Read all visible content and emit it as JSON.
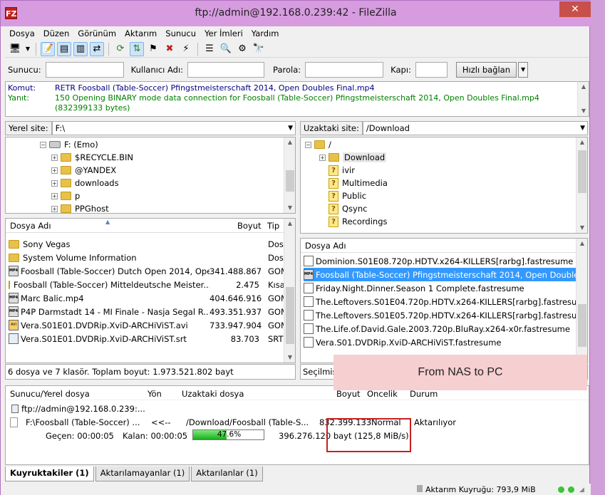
{
  "window": {
    "title": "ftp://admin@192.168.0.239:42 - FileZilla",
    "app_icon": "FZ",
    "close_glyph": "✕"
  },
  "menu": [
    "Dosya",
    "Düzen",
    "Görünüm",
    "Aktarım",
    "Sunucu",
    "Yer İmleri",
    "Yardım"
  ],
  "quickconnect": {
    "host_label": "Sunucu:",
    "user_label": "Kullanıcı Adı:",
    "pass_label": "Parola:",
    "port_label": "Kapı:",
    "button": "Hızlı bağlan",
    "host_value": "",
    "user_value": "",
    "pass_value": "",
    "port_value": ""
  },
  "log": {
    "cmd_label": "Komut:",
    "cmd_text": "RETR Foosball (Table-Soccer) Pfingstmeisterschaft 2014, Open Doubles Final.mp4",
    "resp_label": "Yanıt:",
    "resp_text": "150 Opening BINARY mode data connection for Foosball (Table-Soccer) Pfingstmeisterschaft 2014, Open Doubles Final.mp4 (832399133 bytes)"
  },
  "local": {
    "site_label": "Yerel site:",
    "site_path": "F:\\",
    "tree": {
      "drive": "F: (Emo)",
      "folders": [
        "$RECYCLE.BIN",
        "@YANDEX",
        "downloads",
        "p",
        "PPGhost"
      ]
    },
    "headers": {
      "name": "Dosya Adı",
      "size": "Boyut",
      "type": "Tip"
    },
    "files": [
      {
        "name": "Sony Vegas",
        "size": "",
        "type": "Dosy"
      },
      {
        "name": "System Volume Information",
        "size": "",
        "type": "Dosy"
      },
      {
        "name": "Foosball (Table-Soccer) Dutch Open 2014, Ope...",
        "size": "341.488.867",
        "type": "GOM"
      },
      {
        "name": "Foosball (Table-Soccer) Mitteldeutsche Meister...",
        "size": "2.475",
        "type": "Kısa"
      },
      {
        "name": "Marc Balic.mp4",
        "size": "404.646.916",
        "type": "GOM"
      },
      {
        "name": "P4P Darmstadt  14 - MI Finale - Nasja Segal   R...",
        "size": "493.351.937",
        "type": "GOM"
      },
      {
        "name": "Vera.S01E01.DVDRip.XviD-ARCHiViST.avi",
        "size": "733.947.904",
        "type": "GOM"
      },
      {
        "name": "Vera.S01E01.DVDRip.XviD-ARCHiViST.srt",
        "size": "83.703",
        "type": "SRT"
      }
    ],
    "status": "6 dosya ve 7 klasör. Toplam boyut: 1.973.521.802 bayt"
  },
  "remote": {
    "site_label": "Uzaktaki site:",
    "site_path": "/Download",
    "tree": {
      "root": "/",
      "folders": [
        "Download",
        "ivir",
        "Multimedia",
        "Public",
        "Qsync",
        "Recordings"
      ]
    },
    "headers": {
      "name": "Dosya Adı"
    },
    "files": [
      {
        "name": "Dominion.S01E08.720p.HDTV.x264-KILLERS[rarbg].fastresume",
        "selected": false
      },
      {
        "name": "Foosball (Table-Soccer) Pfingstmeisterschaft 2014, Open Doubles ...",
        "selected": true
      },
      {
        "name": "Friday.Night.Dinner.Season 1 Complete.fastresume",
        "selected": false
      },
      {
        "name": "The.Leftovers.S01E04.720p.HDTV.x264-KILLERS[rarbg].fastresume",
        "selected": false
      },
      {
        "name": "The.Leftovers.S01E05.720p.HDTV.x264-KILLERS[rarbg].fastresume",
        "selected": false
      },
      {
        "name": "The.Life.of.David.Gale.2003.720p.BluRay.x264-x0r.fastresume",
        "selected": false
      },
      {
        "name": "Vera.S01.DVDRip.XviD-ARCHiViST.fastresume",
        "selected": false
      }
    ],
    "status": "Seçilmiş"
  },
  "queue": {
    "headers": {
      "server": "Sunucu/Yerel dosya",
      "dir": "Yön",
      "remote": "Uzaktaki dosya",
      "size": "Boyut",
      "priority": "Öncelik",
      "status": "Durum"
    },
    "server_row": "ftp://admin@192.168.0.239:...",
    "transfer": {
      "local": "F:\\Foosball (Table-Soccer) ...",
      "direction": "<<--",
      "remote": "/Download/Foosball (Table-S...",
      "size": "832.399.133",
      "priority": "Normal",
      "status": "Aktarılıyor"
    },
    "elapsed": "Geçen: 00:00:05",
    "remaining": "Kalan: 00:00:05",
    "progress_text": "47.6%",
    "progress_percent": 47.6,
    "bytes": "396.276.120 bayt (125,8 MiB/s)"
  },
  "tabs": [
    "Kuyruktakiler (1)",
    "Aktarılamayanlar (1)",
    "Aktarılanlar (1)"
  ],
  "bottom_status": "Aktarım Kuyruğu: 793,9 MiB",
  "annotation": "From NAS to PC"
}
